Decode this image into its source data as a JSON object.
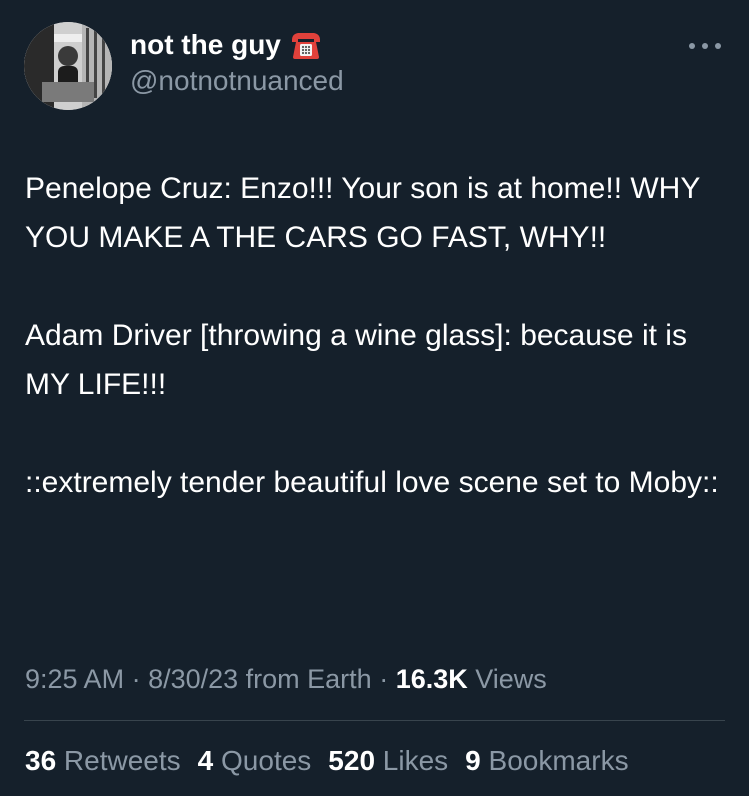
{
  "author": {
    "display_name": "not the guy",
    "handle": "@notnotnuanced",
    "name_emoji": "telephone-icon"
  },
  "tweet": {
    "paragraphs": [
      "Penelope Cruz: Enzo!!! Your son is at home!! WHY YOU MAKE A THE CARS GO FAST, WHY!!",
      "Adam Driver [throwing a wine glass]: because it is MY LIFE!!!",
      "::extremely tender beautiful love scene set to Moby::"
    ]
  },
  "meta": {
    "time": "9:25 AM",
    "separator": " · ",
    "date": "8/30/23",
    "source": " from Earth",
    "views_count": "16.3K",
    "views_label": " Views"
  },
  "stats": {
    "retweets_count": "36",
    "retweets_label": " Retweets",
    "quotes_count": "4",
    "quotes_label": " Quotes",
    "likes_count": "520",
    "likes_label": " Likes",
    "bookmarks_count": "9",
    "bookmarks_label": " Bookmarks"
  },
  "colors": {
    "background": "#15202b",
    "primary_text": "#ffffff",
    "secondary_text": "#8b98a5",
    "divider": "#38444d",
    "phone_emoji": "#e0413b"
  }
}
